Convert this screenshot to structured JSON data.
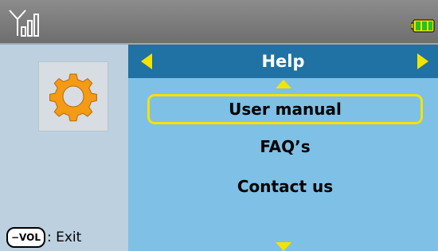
{
  "status_bar": {
    "signal_icon": "signal-strength-icon",
    "battery_icon": "battery-icon",
    "battery_color": "#22c422"
  },
  "sidebar": {
    "settings_icon": "gear-icon",
    "gear_color": "#f59a14",
    "exit_hint": {
      "key_label": "−VOL",
      "label": ": Exit"
    }
  },
  "main": {
    "title": "Help",
    "nav_arrow_color": "#f3e400",
    "accent": "#f3e400",
    "items": [
      {
        "label": "User manual",
        "selected": true
      },
      {
        "label": "FAQ’s",
        "selected": false
      },
      {
        "label": "Contact us",
        "selected": false
      }
    ]
  }
}
